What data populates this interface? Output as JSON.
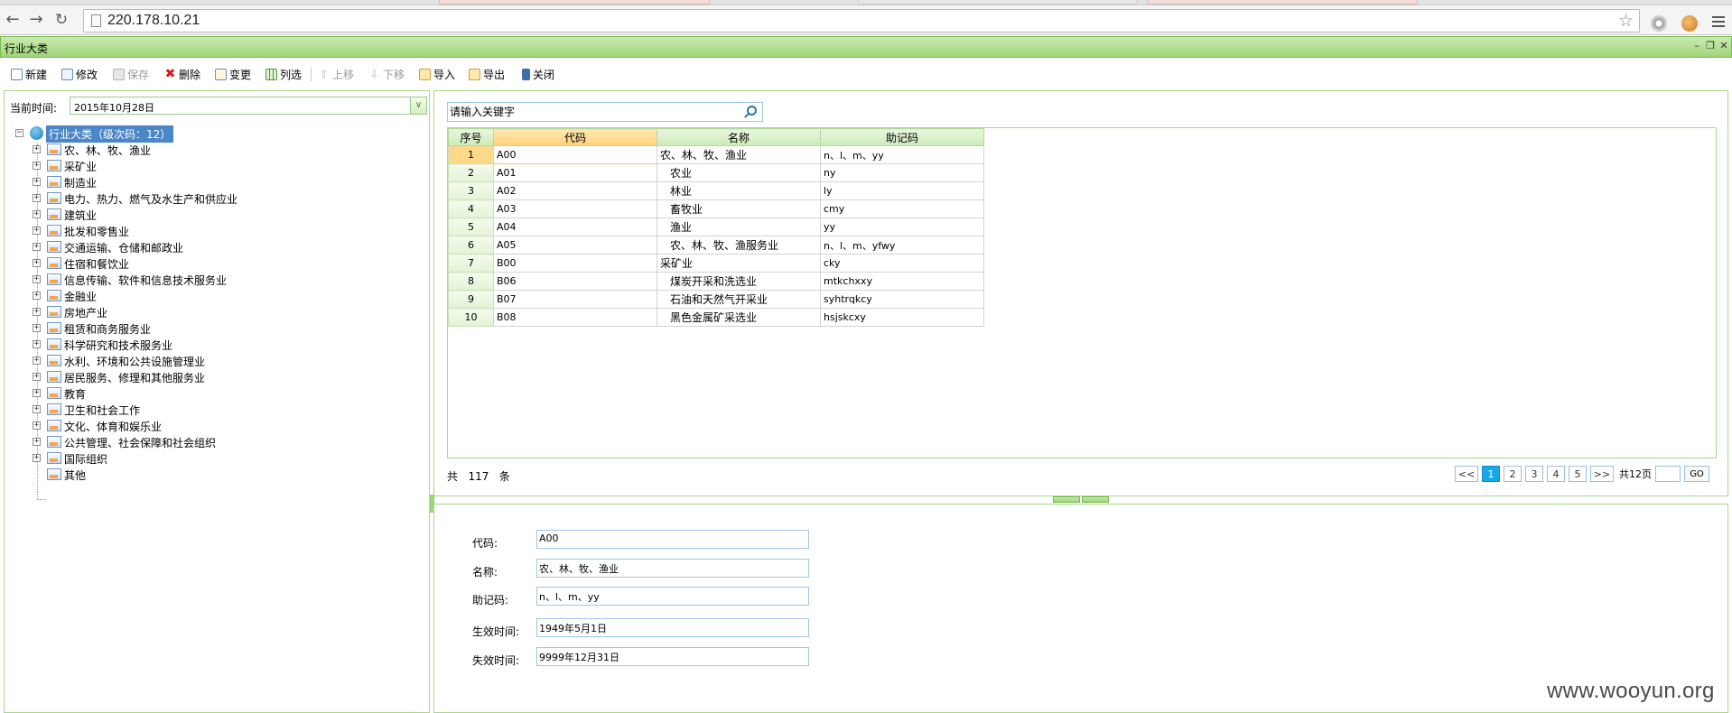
{
  "browser": {
    "url": "220.178.10.21",
    "colors": {
      "accent": "#9fd57a",
      "selection": "#4a86c8",
      "page_active": "#18a8e8"
    }
  },
  "window": {
    "title": "行业大类"
  },
  "toolbar": {
    "new": "新建",
    "edit": "修改",
    "save": "保存",
    "delete": "删除",
    "change": "变更",
    "column_filter": "列选",
    "move_up": "上移",
    "move_down": "下移",
    "import": "导入",
    "export": "导出",
    "close": "关闭"
  },
  "left": {
    "date_label": "当前时间:",
    "date_value": "2015年10月28日",
    "tree_root": "行业大类（级次码：12）",
    "tree_items": [
      "农、林、牧、渔业",
      "采矿业",
      "制造业",
      "电力、热力、燃气及水生产和供应业",
      "建筑业",
      "批发和零售业",
      "交通运输、仓储和邮政业",
      "住宿和餐饮业",
      "信息传输、软件和信息技术服务业",
      "金融业",
      "房地产业",
      "租赁和商务服务业",
      "科学研究和技术服务业",
      "水利、环境和公共设施管理业",
      "居民服务、修理和其他服务业",
      "教育",
      "卫生和社会工作",
      "文化、体育和娱乐业",
      "公共管理、社会保障和社会组织",
      "国际组织",
      "其他"
    ]
  },
  "search": {
    "placeholder": "请输入关键字"
  },
  "grid": {
    "columns": [
      "序号",
      "代码",
      "名称",
      "助记码"
    ],
    "rows": [
      {
        "idx": "1",
        "code": "A00",
        "name": "农、林、牧、渔业",
        "mnemonic": "n、l、m、yy"
      },
      {
        "idx": "2",
        "code": "A01",
        "name": "农业",
        "mnemonic": "ny"
      },
      {
        "idx": "3",
        "code": "A02",
        "name": "林业",
        "mnemonic": "ly"
      },
      {
        "idx": "4",
        "code": "A03",
        "name": "畜牧业",
        "mnemonic": "cmy"
      },
      {
        "idx": "5",
        "code": "A04",
        "name": "渔业",
        "mnemonic": "yy"
      },
      {
        "idx": "6",
        "code": "A05",
        "name": "农、林、牧、渔服务业",
        "mnemonic": "n、l、m、yfwy"
      },
      {
        "idx": "7",
        "code": "B00",
        "name": "采矿业",
        "mnemonic": "cky"
      },
      {
        "idx": "8",
        "code": "B06",
        "name": "煤炭开采和洗选业",
        "mnemonic": "mtkchxxy"
      },
      {
        "idx": "9",
        "code": "B07",
        "name": "石油和天然气开采业",
        "mnemonic": "syhtrqkcy"
      },
      {
        "idx": "10",
        "code": "B08",
        "name": "黑色金属矿采选业",
        "mnemonic": "hsjskcxy"
      }
    ],
    "total_prefix": "共",
    "total_count": "117",
    "total_suffix": "条"
  },
  "pager": {
    "first": "<<",
    "pages": [
      "1",
      "2",
      "3",
      "4",
      "5"
    ],
    "current": "1",
    "next": ">>",
    "total_pages": "共12页",
    "go": "GO"
  },
  "form": {
    "code_label": "代码:",
    "code_value": "A00",
    "name_label": "名称:",
    "name_value": "农、林、牧、渔业",
    "mnemonic_label": "助记码:",
    "mnemonic_value": "n、l、m、yy",
    "effective_label": "生效时间:",
    "effective_value": "1949年5月1日",
    "expiry_label": "失效时间:",
    "expiry_value": "9999年12月31日"
  },
  "watermark": "www.wooyun.org"
}
